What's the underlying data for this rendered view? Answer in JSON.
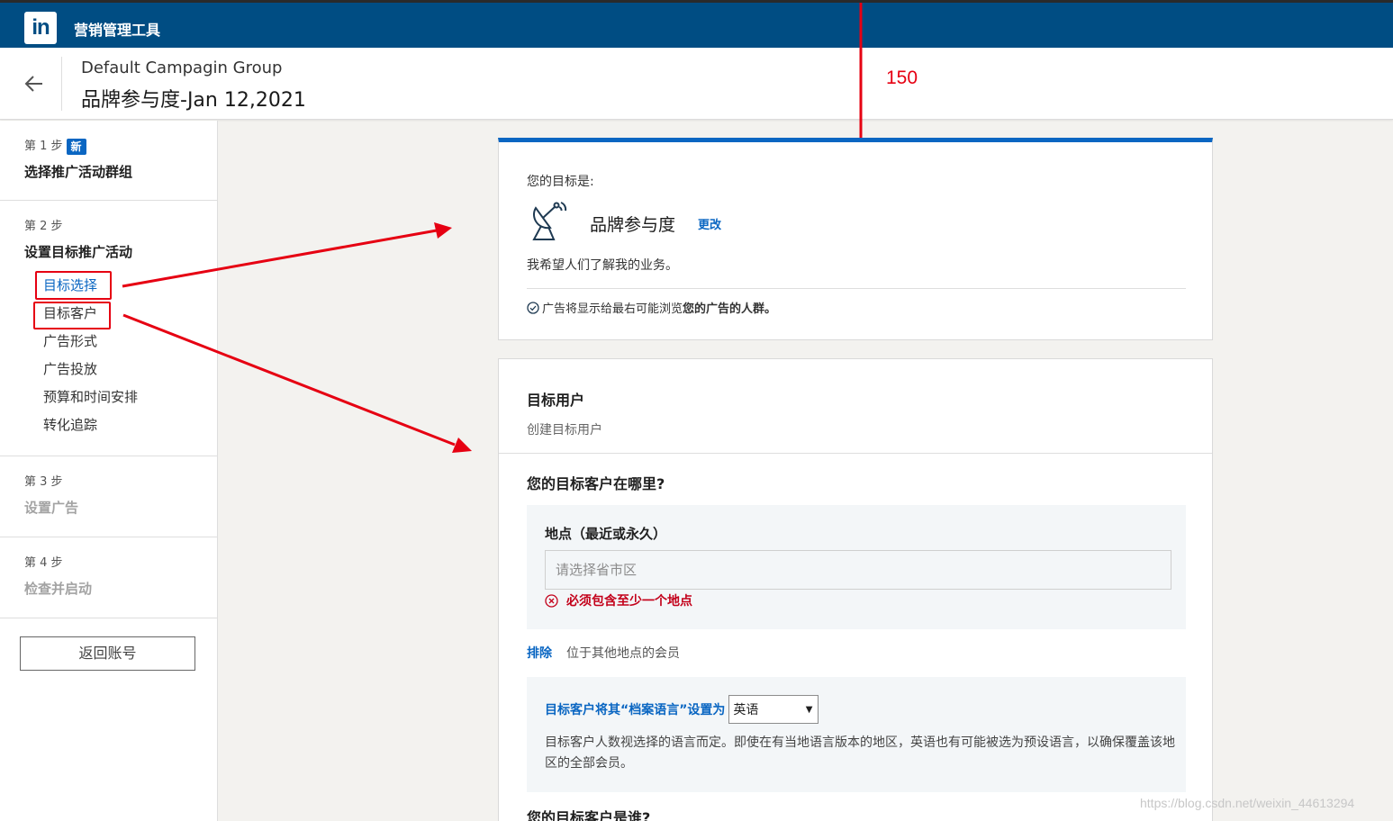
{
  "app": {
    "logo_text": "in",
    "title": "营销管理工具"
  },
  "header": {
    "group_name": "Default Campagin Group",
    "campaign_name": "品牌参与度-Jan 12,2021"
  },
  "sidebar": {
    "steps": [
      {
        "label": "第 1 步",
        "badge": "新",
        "title": "选择推广活动群组"
      },
      {
        "label": "第 2 步",
        "title": "设置目标推广活动",
        "items": [
          "目标选择",
          "目标客户",
          "广告形式",
          "广告投放",
          "预算和时间安排",
          "转化追踪"
        ]
      },
      {
        "label": "第 3 步",
        "title": "设置广告"
      },
      {
        "label": "第 4 步",
        "title": "检查并启动"
      }
    ],
    "return_button": "返回账号"
  },
  "objective": {
    "label": "您的目标是:",
    "name": "品牌参与度",
    "change": "更改",
    "description": "我希望人们了解我的业务。",
    "note_prefix": "广告将显示给最右可能浏览",
    "note_bold": "您的广告的人群。"
  },
  "audience": {
    "title": "目标用户",
    "subtitle": "创建目标用户",
    "where_question": "您的目标客户在哪里?",
    "location_label": "地点（最近或永久）",
    "location_placeholder": "请选择省市区",
    "location_error": "必须包含至少一个地点",
    "exclude_link": "排除",
    "exclude_text": "位于其他地点的会员",
    "language_prompt": "目标客户将其“档案语言”设置为",
    "language_selected": "英语",
    "language_desc": "目标客户人数视选择的语言而定。即使在有当地语言版本的地区，英语也有可能被选为预设语言，以确保覆盖该地区的全部会员。",
    "who_question": "您的目标客户是谁?"
  },
  "annotation": {
    "measure": "150",
    "color": "#e60012"
  },
  "watermark": "https://blog.csdn.net/weixin_44613294",
  "colors": {
    "topbar": "#004d83",
    "accent": "#0a66c2",
    "error": "#c3001a"
  }
}
